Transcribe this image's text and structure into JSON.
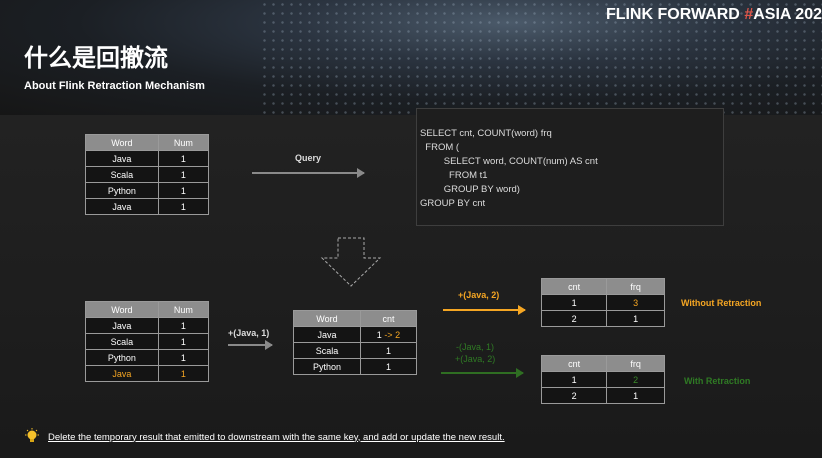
{
  "brand": {
    "prefix": "FLINK FORWARD",
    "hash": "#",
    "suffix": "ASIA 202"
  },
  "title_zh": "什么是回撤流",
  "title_en": "About Flink Retraction Mechanism",
  "source_table": {
    "headers": [
      "Word",
      "Num"
    ],
    "rows": [
      [
        "Java",
        "1"
      ],
      [
        "Scala",
        "1"
      ],
      [
        "Python",
        "1"
      ],
      [
        "Java",
        "1"
      ]
    ]
  },
  "query_label": "Query",
  "sql_lines": [
    "SELECT cnt, COUNT(word) frq",
    "  FROM (",
    "         SELECT word, COUNT(num) AS cnt",
    "           FROM t1",
    "         GROUP BY word)",
    "GROUP BY cnt"
  ],
  "input_table": {
    "headers": [
      "Word",
      "Num"
    ],
    "rows": [
      [
        "Java",
        "1"
      ],
      [
        "Scala",
        "1"
      ],
      [
        "Python",
        "1"
      ],
      [
        "Java",
        "1"
      ]
    ]
  },
  "input_arrow_label": "+(Java, 1)",
  "mid_table": {
    "headers": [
      "Word",
      "cnt"
    ],
    "rows": [
      [
        "Java",
        "1 -> 2"
      ],
      [
        "Scala",
        "1"
      ],
      [
        "Python",
        "1"
      ]
    ],
    "java_from": "1",
    "java_arrow": "->",
    "java_to": "2"
  },
  "without_label": "+(Java, 2)",
  "without_table": {
    "headers": [
      "cnt",
      "frq"
    ],
    "rows": [
      [
        "1",
        "3"
      ],
      [
        "2",
        "1"
      ]
    ]
  },
  "without_title": "Without Retraction",
  "with_labels": [
    "-(Java, 1)",
    "+(Java, 2)"
  ],
  "with_table": {
    "headers": [
      "cnt",
      "frq"
    ],
    "rows": [
      [
        "1",
        "2"
      ],
      [
        "2",
        "1"
      ]
    ]
  },
  "with_title": "With Retraction",
  "footer_text": "Delete the temporary result that emitted to downstream with the same key, and add or update the new result.",
  "colors": {
    "accent_orange": "#f5a623",
    "accent_green": "#3a8a2a",
    "brand_red": "#e0564a"
  }
}
